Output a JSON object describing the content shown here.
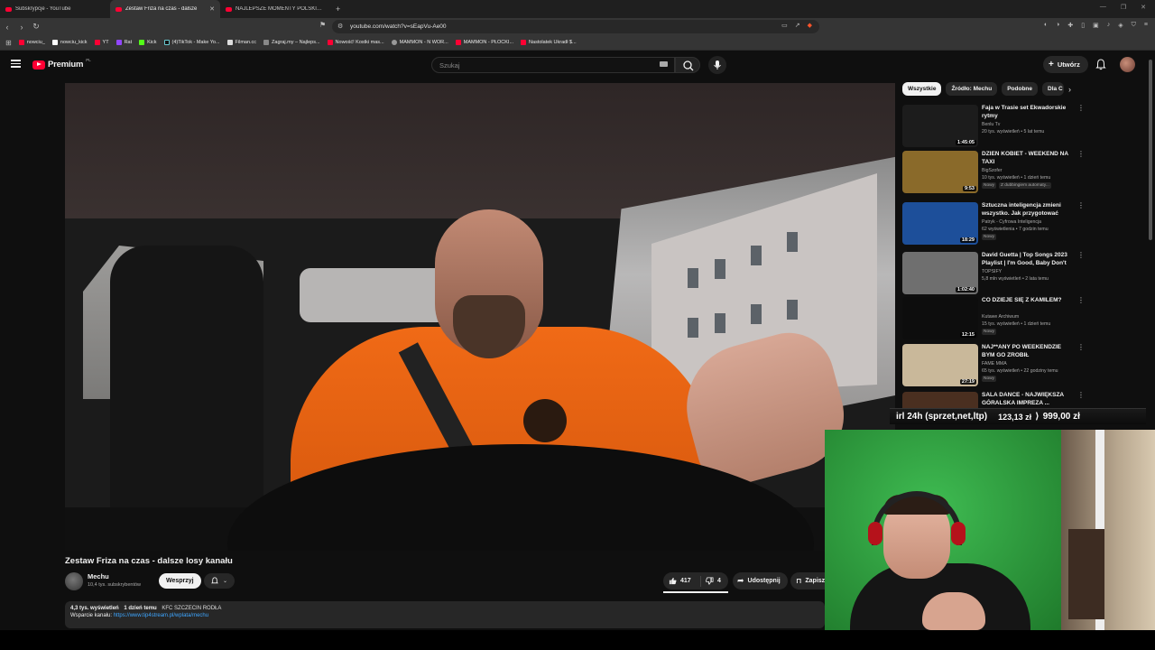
{
  "browser": {
    "tabs": [
      {
        "title": "Subskrypcje - YouTube",
        "active": false
      },
      {
        "title": "Zestaw Friza na czas - dalsze",
        "active": true
      },
      {
        "title": "NAJLEPSZE MOMENTY POLSKIEGO",
        "active": false
      }
    ],
    "url": "youtube.com/watch?v=sEapVu-Ae00",
    "bookmarks": [
      "nowciu_",
      "nowciu_kick",
      "YT",
      "Rat",
      "Kick",
      "(4)TikTok - Make Yo...",
      "Filman.cc",
      "Zagraj.my – Najleps...",
      "Nowość! Kostki mas...",
      "MAMMON - N WOR...",
      "MAMMON - PŁOCKI...",
      "Nastolatek Ukradł $..."
    ]
  },
  "youtube": {
    "logo_text": "Premium",
    "region": "PL",
    "search_placeholder": "Szukaj",
    "create_label": "Utwórz"
  },
  "video": {
    "title": "Zestaw Friza na czas - dalsze losy kanału",
    "channel": "Mechu",
    "subscribers": "10,4 tys. subskrybentów",
    "support_label": "Wesprzyj",
    "likes": "417",
    "dislikes": "4",
    "share_label": "Udostępnij",
    "save_label": "Zapisz",
    "views": "4,3 tys. wyświetleń",
    "published": "1 dzień temu",
    "tag": "KFC SZCZECIN RODŁA",
    "support_text": "Wsparcie kanału:",
    "support_link": "https://www.tip4stream.pl/wplata/mechu"
  },
  "sidebar": {
    "chips": [
      {
        "label": "Wszystkie",
        "active": true
      },
      {
        "label": "Źródło: Mechu",
        "active": false
      },
      {
        "label": "Podobne",
        "active": false
      },
      {
        "label": "Dla C",
        "active": false
      }
    ],
    "recommendations": [
      {
        "title": "Faja w Trasie set Ekwadorskie rytmy",
        "channel": "Benlu Tv",
        "stats": "20 tys. wyświetleń • 5 lat temu",
        "duration": "1:45:05",
        "badges": [],
        "thumb_color": "#1c1c1c"
      },
      {
        "title": "DZIEŃ KOBIET - WEEKEND NA TAXI",
        "channel": "BigSzofer",
        "stats": "10 tys. wyświetleń • 1 dzień temu",
        "duration": "9:53",
        "badges": [
          "Nowy",
          "Z dubbingiem automaty..."
        ],
        "thumb_color": "#8a6a2a"
      },
      {
        "title": "Sztuczna inteligencja zmieni wszystko. Jak przygotować się...",
        "channel": "Patryk - Cyfrowa Inteligencja",
        "stats": "62 wyświetlenia • 7 godzin temu",
        "duration": "18:29",
        "badges": [
          "Nowy"
        ],
        "thumb_color": "#1d4f9a"
      },
      {
        "title": "David Guetta | Top Songs 2023 Playlist | I'm Good, Baby Don't ...",
        "channel": "TOPSIFY",
        "stats": "5,8 mln wyświetleń • 2 lata temu",
        "duration": "1:02:40",
        "badges": [],
        "thumb_color": "#6f6f6f"
      },
      {
        "title": "CO DZIEJE SIĘ Z KAMILEM?",
        "channel": "Kutawe Archiwum",
        "stats": "15 tys. wyświetleń • 1 dzień temu",
        "duration": "12:15",
        "badges": [
          "Nowy"
        ],
        "thumb_color": "#0d0d0d"
      },
      {
        "title": "NAJ**ANY PO WEEKENDZIE BYM GO ZROBIŁ",
        "channel": "FAME MMA",
        "stats": "65 tys. wyświetleń • 22 godziny temu",
        "duration": "27:19",
        "badges": [
          "Nowy"
        ],
        "thumb_color": "#c9b89a"
      },
      {
        "title": "SALA DANCE - NAJWIĘKSZA GÓRALSKA IMPREZA ...",
        "channel": "",
        "stats": "",
        "duration": "",
        "badges": [],
        "thumb_color": "#4a2f20"
      }
    ]
  },
  "overlay": {
    "goal_label": "irl 24h (sprzet,net,ltp)",
    "current": "123,13 zł",
    "target": "999,00 zł",
    "progress": 0.1233
  },
  "colors": {
    "accent_red": "#ff0033",
    "link_blue": "#3ea6ff",
    "background": "#0f0f0f"
  }
}
